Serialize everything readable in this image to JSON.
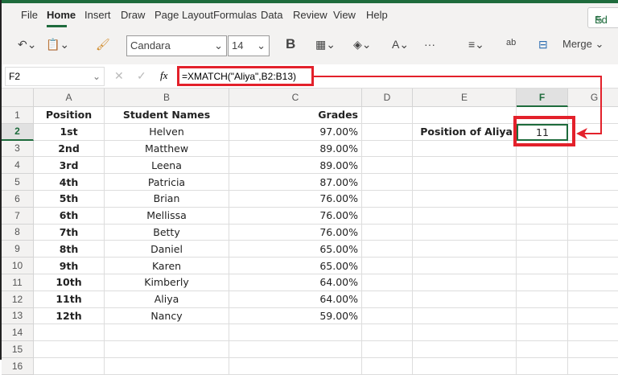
{
  "menu": {
    "items": [
      "File",
      "Home",
      "Insert",
      "Draw",
      "Page Layout",
      "Formulas",
      "Data",
      "Review",
      "View",
      "Help"
    ],
    "active": "Home",
    "edit_label": "Ed"
  },
  "ribbon": {
    "font": "Candara",
    "size": "14",
    "bold": "B",
    "merge": "Merge"
  },
  "formula_bar": {
    "name_box": "F2",
    "fx": "fx",
    "formula": "=XMATCH(\"Aliya\",B2:B13)"
  },
  "columns": [
    "A",
    "B",
    "C",
    "D",
    "E",
    "F",
    "G"
  ],
  "rows": [
    "1",
    "2",
    "3",
    "4",
    "5",
    "6",
    "7",
    "8",
    "9",
    "10",
    "11",
    "12",
    "13",
    "14",
    "15",
    "16"
  ],
  "headers": {
    "position": "Position",
    "names": "Student Names",
    "grades": "Grades"
  },
  "data": [
    [
      "1st",
      "Helven",
      "97.00%"
    ],
    [
      "2nd",
      "Matthew",
      "89.00%"
    ],
    [
      "3rd",
      "Leena",
      "89.00%"
    ],
    [
      "4th",
      "Patricia",
      "87.00%"
    ],
    [
      "5th",
      "Brian",
      "76.00%"
    ],
    [
      "6th",
      "Mellissa",
      "76.00%"
    ],
    [
      "7th",
      "Betty",
      "76.00%"
    ],
    [
      "8th",
      "Daniel",
      "65.00%"
    ],
    [
      "9th",
      "Karen",
      "65.00%"
    ],
    [
      "10th",
      "Kimberly",
      "64.00%"
    ],
    [
      "11th",
      "Aliya",
      "64.00%"
    ],
    [
      "12th",
      "Nancy",
      "59.00%"
    ]
  ],
  "lookup": {
    "label": "Position of Aliya",
    "result": "11"
  },
  "colors": {
    "accent": "#1e6b3c",
    "highlight": "#e3212b"
  }
}
